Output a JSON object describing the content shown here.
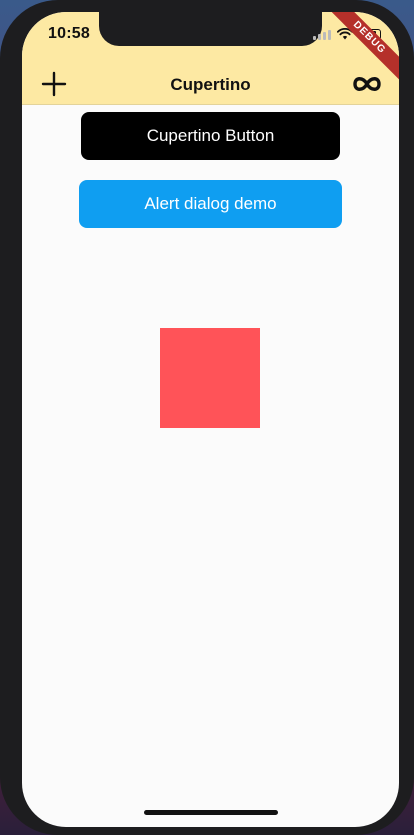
{
  "status_bar": {
    "time": "10:58"
  },
  "debug_banner": {
    "label": "DEBUG",
    "color": "#b5302a"
  },
  "nav_bar": {
    "title": "Cupertino",
    "background": "#fde9a3",
    "leading_icon": "plus-icon",
    "trailing_icon": "infinity-icon"
  },
  "buttons": {
    "cupertino_label": "Cupertino Button",
    "cupertino_color": "#000000",
    "alert_label": "Alert dialog demo",
    "alert_color": "#0f9ef1"
  },
  "square": {
    "color": "#ff5358"
  }
}
